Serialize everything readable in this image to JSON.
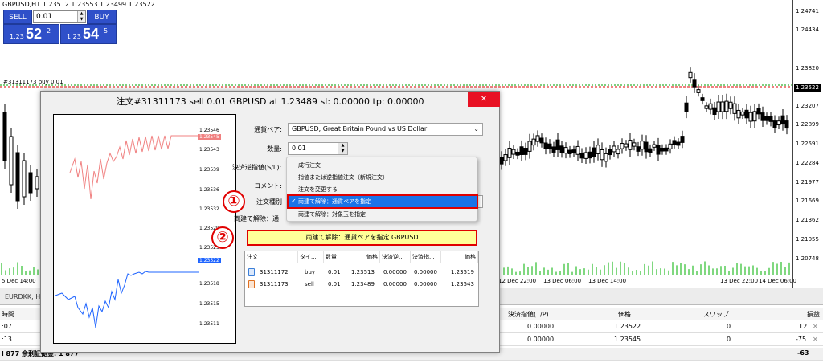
{
  "chart": {
    "title": "GBPUSD,H1  1.23512 1.23553 1.23499 1.23522",
    "order_line_label": "#31311173 buy 0.01",
    "price_labels": [
      "1.24741",
      "1.24434",
      "1.23820",
      "1.23522",
      "1.23207",
      "1.22899",
      "1.22591",
      "1.22284",
      "1.21977",
      "1.21669",
      "1.21362",
      "1.21055",
      "1.20748"
    ],
    "current_price": "1.23522",
    "time_labels": [
      "5 Dec 14:00",
      "12 Dec 22:00",
      "13 Dec 06:00",
      "13 Dec 14:00",
      "13 Dec 22:00",
      "14 Dec 06:00"
    ],
    "colors": {
      "bid_line": "#00a000",
      "order_line": "#e00000",
      "current_tag": "#000000"
    }
  },
  "oneclick": {
    "sell_label": "SELL",
    "buy_label": "BUY",
    "lot_value": "0.01",
    "sell_small": "1.23",
    "sell_big": "52",
    "sell_sup": "2",
    "buy_small": "1.23",
    "buy_big": "54",
    "buy_sup": "5"
  },
  "terminal": {
    "tab_label": "EURDKK, H1",
    "header": {
      "col_time": "時間",
      "col_tp": "決済指値(T/P)",
      "col_price": "価格",
      "col_swap": "スワップ",
      "col_pl": "損益"
    },
    "rows": [
      {
        "time": ":07",
        "tp": "0.00000",
        "price": "1.23522",
        "swap": "0",
        "pl": "12"
      },
      {
        "time": ":13",
        "tp": "0.00000",
        "price": "1.23545",
        "swap": "0",
        "pl": "-75"
      }
    ],
    "footer": {
      "balance_text": "l 877  余剰証拠金: 1 877",
      "total": "-63"
    },
    "close_icon": "x-icon"
  },
  "dialog": {
    "title": "注文#31311173 sell 0.01 GBPUSD at 1.23489 sl: 0.00000 tp: 0.00000",
    "close_icon": "close-icon",
    "mini_chart": {
      "labels": [
        "1.23546",
        "1.23543",
        "1.23539",
        "1.23536",
        "1.23532",
        "1.23529",
        "1.23525",
        "1.23522",
        "1.23518",
        "1.23515",
        "1.23511"
      ],
      "ask_tag": "1.23545",
      "bid_tag": "1.23522",
      "ask_color": "#f08080",
      "bid_color": "#1e64ff"
    },
    "symbol_label": "通貨ペア:",
    "symbol_value": "GBPUSD, Great Britain Pound vs US Dollar",
    "volume_label": "数量:",
    "volume_value": "0.01",
    "sl_label": "決済逆指値(S/L):",
    "comment_label": "コメント:",
    "type_label": "注文種別",
    "close_by_label": "両建て解除：通",
    "dropdown_items": [
      "成行注文",
      "指値または逆指値注文（新規注文）",
      "注文を変更する",
      "両建て解除：通貨ペアを指定",
      "両建て解除：対象玉を指定"
    ],
    "selected_index": 3,
    "marker_1": "①",
    "marker_2": "②",
    "close_by_button": "両建て解除：通貨ペアを指定 GBPUSD",
    "orders_header": [
      "注文",
      "タイ...",
      "数量",
      "価格",
      "決済逆...",
      "決済指...",
      "価格"
    ],
    "orders": [
      {
        "id": "31311172",
        "type": "buy",
        "volume": "0.01",
        "price": "1.23513",
        "sl": "0.00000",
        "tp": "0.00000",
        "cur": "1.23519",
        "icon_color": "#3b7fd9"
      },
      {
        "id": "31311173",
        "type": "sell",
        "volume": "0.01",
        "price": "1.23489",
        "sl": "0.00000",
        "tp": "0.00000",
        "cur": "1.23543",
        "icon_color": "#e07020"
      }
    ]
  }
}
